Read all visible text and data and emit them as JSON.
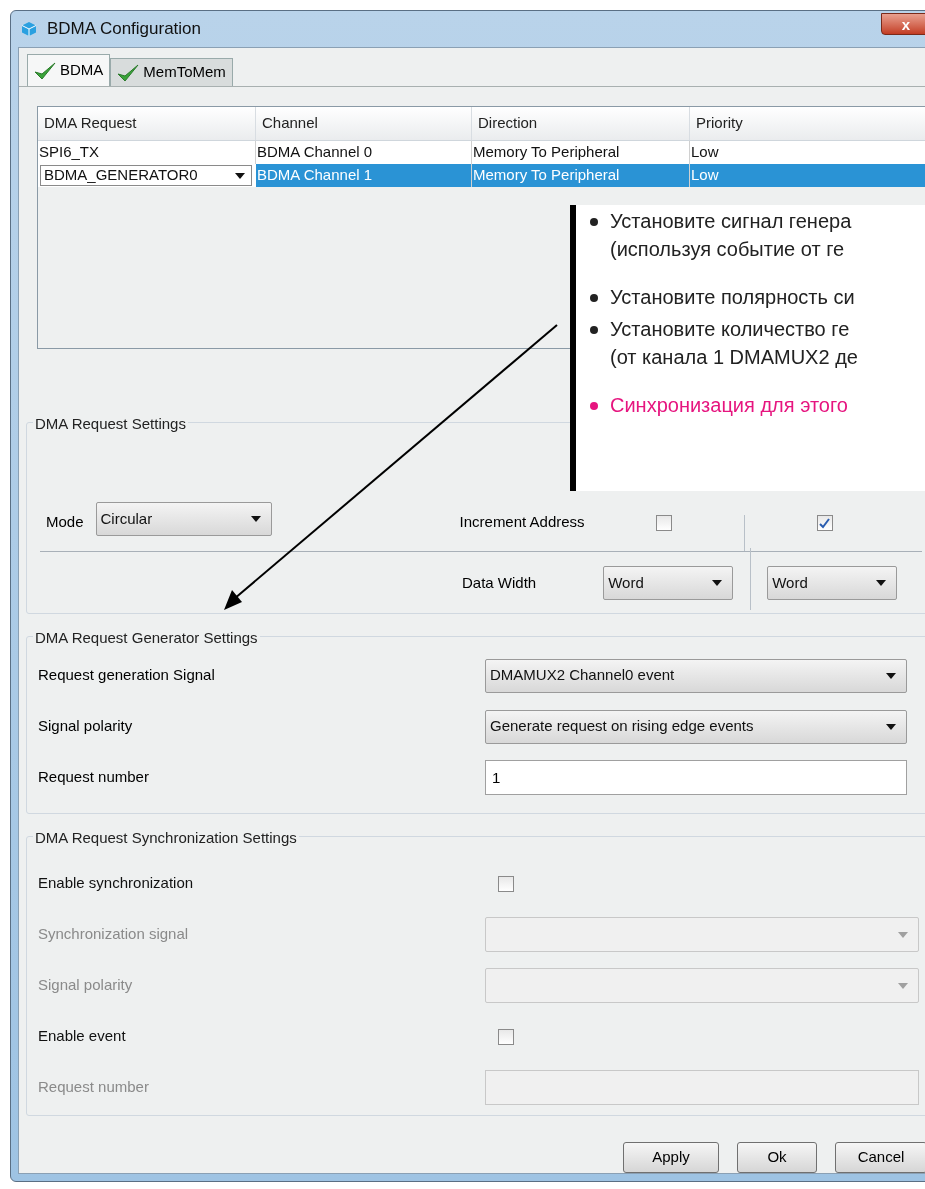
{
  "window": {
    "title": "BDMA Configuration",
    "close": "x"
  },
  "tabs": [
    {
      "label": "BDMA",
      "selected": true
    },
    {
      "label": "MemToMem",
      "selected": false
    }
  ],
  "table": {
    "columns": [
      "DMA Request",
      "Channel",
      "Direction",
      "Priority"
    ],
    "rows": [
      {
        "kind": "text",
        "selected": false,
        "cells": [
          "SPI6_TX",
          "BDMA Channel 0",
          "Memory To Peripheral",
          "Low"
        ]
      },
      {
        "kind": "dropdown",
        "selected": true,
        "cells": [
          "BDMA_GENERATOR0",
          "BDMA Channel 1",
          "Memory To Peripheral",
          "Low"
        ]
      }
    ]
  },
  "request_settings": {
    "title": "DMA Request Settings",
    "mode": {
      "label": "Mode",
      "value": "Circular"
    },
    "increment_address": {
      "label": "Increment Address",
      "boxes": [
        {
          "checked": false
        },
        {
          "checked": true
        }
      ]
    },
    "data_width": {
      "label": "Data Width",
      "values": [
        "Word",
        "Word"
      ]
    }
  },
  "generator_settings": {
    "title": "DMA Request Generator Settings",
    "rows": [
      {
        "kind": "select",
        "label": "Request generation Signal",
        "value": "DMAMUX2 Channel0 event"
      },
      {
        "kind": "select",
        "label": "Signal polarity",
        "value": "Generate request on rising edge events"
      },
      {
        "kind": "input",
        "label": "Request number",
        "value": "1"
      }
    ]
  },
  "sync_settings": {
    "title": "DMA Request Synchronization Settings",
    "rows": [
      {
        "kind": "checkbox",
        "label": "Enable synchronization",
        "checked": false,
        "disabled": false
      },
      {
        "kind": "select",
        "label": "Synchronization signal",
        "disabled": true
      },
      {
        "kind": "select",
        "label": "Signal polarity",
        "disabled": true
      },
      {
        "kind": "checkbox",
        "label": "Enable event",
        "checked": false,
        "disabled": false
      },
      {
        "kind": "input",
        "label": "Request number",
        "disabled": true
      }
    ]
  },
  "buttons": [
    "Apply",
    "Ok",
    "Cancel"
  ],
  "callout": {
    "groups": [
      {
        "items": [
          {
            "text": "Установите сигнал генера\n(используя событие от ге",
            "color": "#222222"
          }
        ]
      },
      {
        "items": [
          {
            "text": "Установите полярность си",
            "color": "#222222"
          },
          {
            "text": "Установите количество ге\n(от канала 1 DMAMUX2 де",
            "color": "#222222"
          }
        ]
      },
      {
        "items": [
          {
            "text": "Синхронизация для этого",
            "color": "#e6157f"
          }
        ]
      }
    ]
  }
}
